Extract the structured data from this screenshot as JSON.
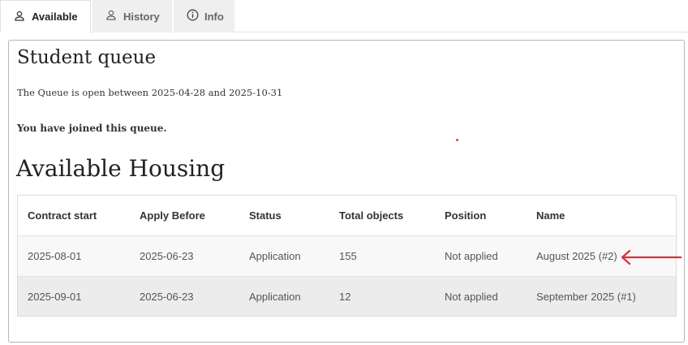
{
  "tabs": [
    {
      "label": "Available",
      "icon": "person-icon",
      "active": true
    },
    {
      "label": "History",
      "icon": "person-icon",
      "active": false
    },
    {
      "label": "Info",
      "icon": "info-circle-icon",
      "active": false
    }
  ],
  "queue": {
    "title": "Student queue",
    "open_text": "The Queue is open between 2025-04-28 and 2025-10-31",
    "joined_text": "You have joined this queue."
  },
  "housing": {
    "title": "Available Housing",
    "columns": [
      "Contract start",
      "Apply Before",
      "Status",
      "Total objects",
      "Position",
      "Name"
    ],
    "rows": [
      [
        "2025-08-01",
        "2025-06-23",
        "Application",
        "155",
        "Not applied",
        "August 2025 (#2)"
      ],
      [
        "2025-09-01",
        "2025-06-23",
        "Application",
        "12",
        "Not applied",
        "September 2025 (#1)"
      ]
    ]
  },
  "colors": {
    "annotation_arrow": "#d9303a",
    "panel_border": "#b5b5b5"
  }
}
